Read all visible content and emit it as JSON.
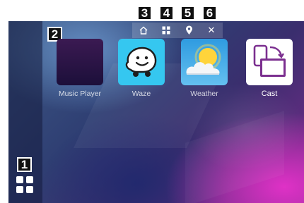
{
  "callouts": [
    "1",
    "2",
    "3",
    "4",
    "5",
    "6"
  ],
  "toolbar": {
    "buttons": [
      {
        "icon": "home-icon"
      },
      {
        "icon": "grid-icon"
      },
      {
        "icon": "location-pin-icon"
      },
      {
        "icon": "close-icon",
        "glyph": "✕"
      }
    ]
  },
  "launcher": {
    "apps": [
      {
        "label": "Music Player",
        "icon": "music-waveform-icon"
      },
      {
        "label": "Waze",
        "icon": "waze-icon"
      },
      {
        "label": "Weather",
        "icon": "weather-sun-cloud-icon"
      },
      {
        "label": "Cast",
        "icon": "cast-screens-icon"
      }
    ],
    "all_apps_icon": "apps-grid-icon"
  },
  "colors": {
    "callout_bg": "#111111",
    "waze_tile": "#35c7f0",
    "cast_accent": "#7b2f8f"
  }
}
